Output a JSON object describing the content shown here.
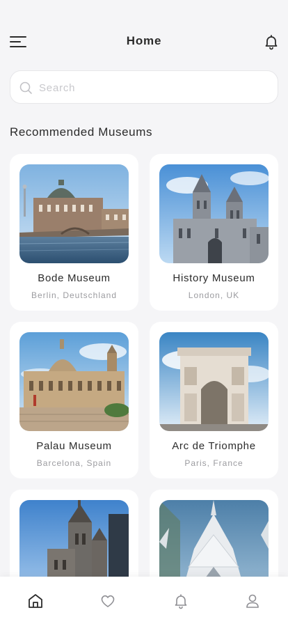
{
  "header": {
    "title": "Home"
  },
  "search": {
    "placeholder": "Search"
  },
  "section": {
    "title": "Recommended Museums"
  },
  "museums": [
    {
      "name": "Bode Museum",
      "location": "Berlin, Deutschland"
    },
    {
      "name": "History Museum",
      "location": "London, UK"
    },
    {
      "name": "Palau Museum",
      "location": "Barcelona, Spain"
    },
    {
      "name": "Arc de Triomphe",
      "location": "Paris, France"
    },
    {
      "name": "",
      "location": ""
    },
    {
      "name": "",
      "location": ""
    }
  ],
  "nav": {
    "items": [
      "home-icon",
      "heart-icon",
      "bell-icon",
      "user-icon"
    ],
    "active": "home-icon"
  },
  "colors": {
    "background": "#f5f5f7",
    "card": "#ffffff",
    "text": "#2b2b2b",
    "muted": "#9b9b9f",
    "sky": "#4a90d6"
  }
}
